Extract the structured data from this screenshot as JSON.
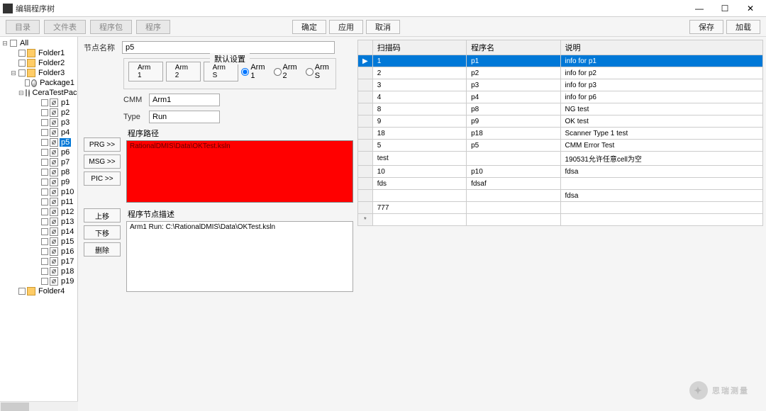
{
  "window": {
    "title": "编辑程序树",
    "minimize": "—",
    "maximize": "☐",
    "close": "✕"
  },
  "toolbar": {
    "btn_dir": "目录",
    "btn_filelist": "文件表",
    "btn_proglist": "程序包",
    "btn_prog": "程序",
    "btn_confirm": "确定",
    "btn_apply": "应用",
    "btn_cancel": "取消",
    "btn_save": "保存",
    "btn_load": "加载"
  },
  "tree": {
    "root": "All",
    "folders": [
      "Folder1",
      "Folder2",
      "Folder3",
      "Folder4"
    ],
    "f3_children": [
      "Package1",
      "CeraTestPack"
    ],
    "progs": [
      "p1",
      "p2",
      "p3",
      "p4",
      "p5",
      "p6",
      "p7",
      "p8",
      "p9",
      "p10",
      "p11",
      "p12",
      "p13",
      "p14",
      "p15",
      "p16",
      "p17",
      "p18",
      "p19"
    ],
    "selected": "p5"
  },
  "form": {
    "name_label": "节点名称",
    "name_value": "p5",
    "param_title": "默认设置",
    "arm1": "Arm 1",
    "arm2": "Arm 2",
    "arms": "Arm S",
    "radio_arm1": "Arm 1",
    "radio_arm2": "Arm 2",
    "radio_arms": "Arm S",
    "cmm_label": "CMM",
    "cmm_value": "Arm1",
    "type_label": "Type",
    "type_value": "Run",
    "path_label": "程序路径",
    "path_text": "RationalDMIS\\Data\\OKTest.ksln",
    "desc_label": "程序节点描述",
    "desc_text": "Arm1 Run: C:\\RationalDMIS\\Data\\OKTest.ksln",
    "btn_prg": "PRG >>",
    "btn_msg": "MSG >>",
    "btn_pic": "PIC >>",
    "btn_up": "上移",
    "btn_down": "下移",
    "btn_delete": "删除"
  },
  "grid": {
    "col_scan": "扫描码",
    "col_prog": "程序名",
    "col_desc": "说明",
    "rows": [
      {
        "scan": "1",
        "prog": "p1",
        "desc": "info for p1",
        "selected": true
      },
      {
        "scan": "2",
        "prog": "p2",
        "desc": "info for p2"
      },
      {
        "scan": "3",
        "prog": "p3",
        "desc": "info for p3"
      },
      {
        "scan": "4",
        "prog": "p4",
        "desc": "info for p6"
      },
      {
        "scan": "8",
        "prog": "p8",
        "desc": "NG test"
      },
      {
        "scan": "9",
        "prog": "p9",
        "desc": "OK test"
      },
      {
        "scan": "18",
        "prog": "p18",
        "desc": "Scanner Type 1 test"
      },
      {
        "scan": "5",
        "prog": "p5",
        "desc": "CMM Error Test"
      },
      {
        "scan": "test",
        "prog": "",
        "desc": "190531允许任意cell为空"
      },
      {
        "scan": "10",
        "prog": "p10",
        "desc": "fdsa"
      },
      {
        "scan": "fds",
        "prog": "fdsaf",
        "desc": ""
      },
      {
        "scan": "",
        "prog": "",
        "desc": "fdsa"
      },
      {
        "scan": "777",
        "prog": "",
        "desc": ""
      }
    ],
    "newrow_mark": "*"
  },
  "watermark": "思瑞测量"
}
